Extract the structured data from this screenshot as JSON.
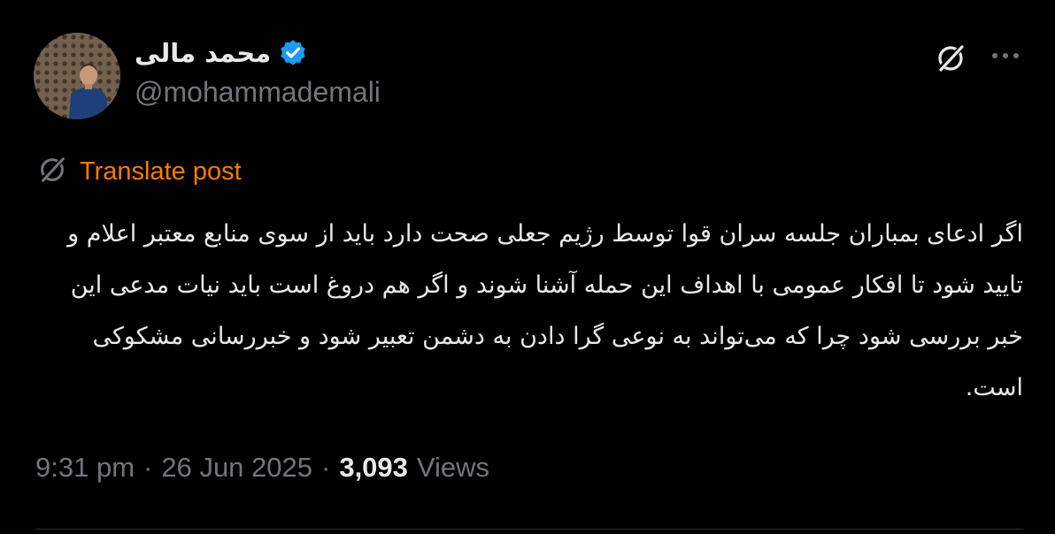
{
  "post": {
    "author": {
      "display_name": "محمد مالی",
      "handle": "@mohammademali",
      "verified": true,
      "avatar_icon": "user-avatar-photo"
    },
    "actions": {
      "grok_icon": "grok-icon",
      "more_icon": "more-options-icon"
    },
    "translate_label": "Translate post",
    "body": "اگر ادعای بمباران جلسه سران قوا توسط رژیم جعلی صحت دارد باید از سوی منابع معتبر اعلام و تایید شود تا افکار عمومی با اهداف این حمله آشنا شوند و اگر هم دروغ است باید نیات مدعی این خبر بررسی شود چرا که می‌تواند به نوعی گرا دادن به دشمن تعبیر شود و خبررسانی مشکوکی است.",
    "meta": {
      "time": "9:31 pm",
      "separator": "·",
      "date": "26 Jun 2025",
      "views_count": "3,093",
      "views_label": "Views"
    }
  },
  "colors": {
    "background": "#000000",
    "text": "#e7e9ea",
    "secondary": "#71767b",
    "translate_accent": "#ff7a00",
    "verified_blue": "#1d9bf0"
  }
}
